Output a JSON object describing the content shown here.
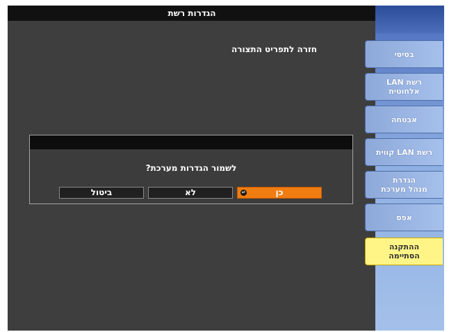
{
  "window": {
    "title": "הגדרות רשת"
  },
  "main": {
    "back_link": "חזרה לתפריט התצורה"
  },
  "sidebar": {
    "items": [
      {
        "label": "בסיסי"
      },
      {
        "label": "רשת LAN\nאלחוטית"
      },
      {
        "label": "אבטחה"
      },
      {
        "label": "רשת LAN קווית"
      },
      {
        "label": "הגדרת\nמנהל מערכת"
      },
      {
        "label": "אפס"
      },
      {
        "label": "ההתקנה\nהסתיימה"
      }
    ],
    "active_index": 6
  },
  "dialog": {
    "question": "לשמור הגדרות מערכת?",
    "buttons": {
      "yes_label": "כן",
      "no_label": "לא",
      "cancel_label": "ביטול"
    }
  },
  "colors": {
    "background": "#3e3e3e",
    "sidebar": "#8fb0e2",
    "active_tab": "#fff587",
    "selected_button": "#f07c12"
  },
  "icons": {
    "selected_indicator": "enter-icon"
  }
}
